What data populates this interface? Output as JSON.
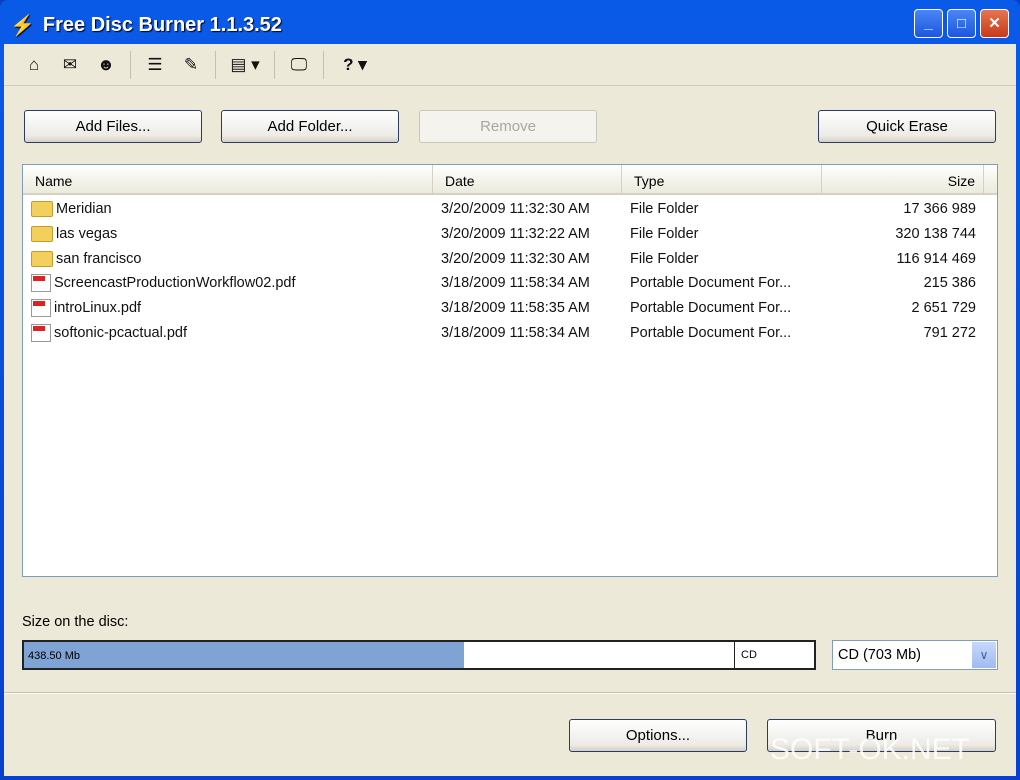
{
  "window": {
    "title": "Free Disc Burner 1.1.3.52"
  },
  "buttons": {
    "add_files": "Add Files...",
    "add_folder": "Add Folder...",
    "remove": "Remove",
    "quick_erase": "Quick Erase",
    "options": "Options...",
    "burn": "Burn"
  },
  "columns": [
    "Name",
    "Date",
    "Type",
    "Size"
  ],
  "files": [
    {
      "name": "Meridian",
      "date": "3/20/2009 11:32:30 AM",
      "type": "File Folder",
      "size": "17 366 989",
      "icon": "folder"
    },
    {
      "name": "las vegas",
      "date": "3/20/2009 11:32:22 AM",
      "type": "File Folder",
      "size": "320 138 744",
      "icon": "folder"
    },
    {
      "name": "san francisco",
      "date": "3/20/2009 11:32:30 AM",
      "type": "File Folder",
      "size": "116 914 469",
      "icon": "folder"
    },
    {
      "name": "ScreencastProductionWorkflow02.pdf",
      "date": "3/18/2009 11:58:34 AM",
      "type": "Portable Document For...",
      "size": "215 386",
      "icon": "pdf"
    },
    {
      "name": "introLinux.pdf",
      "date": "3/18/2009 11:58:35 AM",
      "type": "Portable Document For...",
      "size": "2 651 729",
      "icon": "pdf"
    },
    {
      "name": "softonic-pcactual.pdf",
      "date": "3/18/2009 11:58:34 AM",
      "type": "Portable Document For...",
      "size": "791 272",
      "icon": "pdf"
    }
  ],
  "disc": {
    "label": "Size on the disc:",
    "used": "438.50 Mb",
    "fraction": 0.62,
    "media": "CD",
    "selected": "CD (703 Mb)"
  },
  "watermark": "SOFT-OK.NET"
}
